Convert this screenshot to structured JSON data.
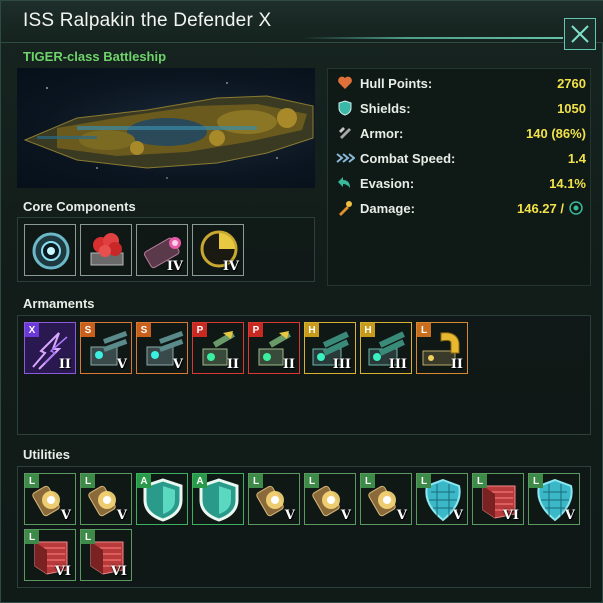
{
  "window": {
    "title": "ISS Ralpakin the Defender X",
    "ship_class": "TIGER-class Battleship",
    "close_icon": "close-icon"
  },
  "stats": [
    {
      "label": "Hull Points:",
      "value": "2760",
      "icon": "heart-icon",
      "color": "#e0703a"
    },
    {
      "label": "Shields:",
      "value": "1050",
      "icon": "shield-icon",
      "color": "#3ab8a8"
    },
    {
      "label": "Armor:",
      "value": "140 (86%)",
      "icon": "armor-icon",
      "color": "#a8a8a8"
    },
    {
      "label": "Combat Speed:",
      "value": "1.4",
      "icon": "speed-icon",
      "color": "#8ab8d8"
    },
    {
      "label": "Evasion:",
      "value": "14.1%",
      "icon": "evasion-icon",
      "color": "#3ab89a"
    },
    {
      "label": "Damage:",
      "value": "146.27 /",
      "icon": "damage-icon",
      "color": "#e0902a"
    }
  ],
  "sections": {
    "core": "Core Components",
    "armaments": "Armaments",
    "utilities": "Utilities"
  },
  "core_components": [
    {
      "name": "sensor",
      "tier": "",
      "icon": "sensor-icon"
    },
    {
      "name": "combat-computer",
      "tier": "",
      "icon": "computer-chip-icon"
    },
    {
      "name": "thruster",
      "tier": "IV",
      "icon": "thruster-icon"
    },
    {
      "name": "reactor",
      "tier": "IV",
      "icon": "reactor-icon"
    }
  ],
  "armaments": [
    {
      "size": "X",
      "tier": "II",
      "icon": "lightning-weapon-icon"
    },
    {
      "size": "S",
      "tier": "V",
      "icon": "turret-icon"
    },
    {
      "size": "S",
      "tier": "V",
      "icon": "turret-icon"
    },
    {
      "size": "P",
      "tier": "II",
      "icon": "point-defense-icon"
    },
    {
      "size": "P",
      "tier": "II",
      "icon": "point-defense-icon"
    },
    {
      "size": "H",
      "tier": "III",
      "icon": "hangar-icon"
    },
    {
      "size": "H",
      "tier": "III",
      "icon": "hangar-icon"
    },
    {
      "size": "L",
      "tier": "II",
      "icon": "large-weapon-icon"
    }
  ],
  "utilities": [
    {
      "size": "L",
      "tier": "V",
      "icon": "reactor-capsule-icon"
    },
    {
      "size": "L",
      "tier": "V",
      "icon": "reactor-capsule-icon"
    },
    {
      "size": "A",
      "tier": "",
      "icon": "shield-icon"
    },
    {
      "size": "A",
      "tier": "",
      "icon": "shield-icon"
    },
    {
      "size": "L",
      "tier": "V",
      "icon": "reactor-capsule-icon"
    },
    {
      "size": "L",
      "tier": "V",
      "icon": "reactor-capsule-icon"
    },
    {
      "size": "L",
      "tier": "V",
      "icon": "reactor-capsule-icon"
    },
    {
      "size": "L",
      "tier": "V",
      "icon": "hex-shield-icon"
    },
    {
      "size": "L",
      "tier": "VI",
      "icon": "armor-plate-icon"
    },
    {
      "size": "L",
      "tier": "V",
      "icon": "hex-shield-icon"
    },
    {
      "size": "L",
      "tier": "VI",
      "icon": "armor-plate-icon"
    },
    {
      "size": "L",
      "tier": "VI",
      "icon": "armor-plate-icon"
    }
  ]
}
